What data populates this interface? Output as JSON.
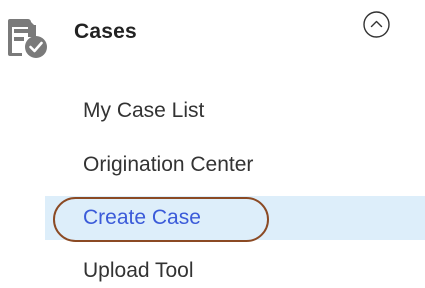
{
  "section": {
    "title": "Cases",
    "icon": "cases-icon",
    "toggle_icon": "chevron-up-circle-icon"
  },
  "menu": {
    "items": [
      {
        "label": "My Case List",
        "active": false
      },
      {
        "label": "Origination Center",
        "active": false
      },
      {
        "label": "Create Case",
        "active": true
      },
      {
        "label": "Upload Tool",
        "active": false
      }
    ]
  },
  "colors": {
    "active_background": "#ddeefa",
    "active_text": "#3b5bd9",
    "highlight_ring": "#8b4a24",
    "icon_gray": "#7a7a7a"
  }
}
